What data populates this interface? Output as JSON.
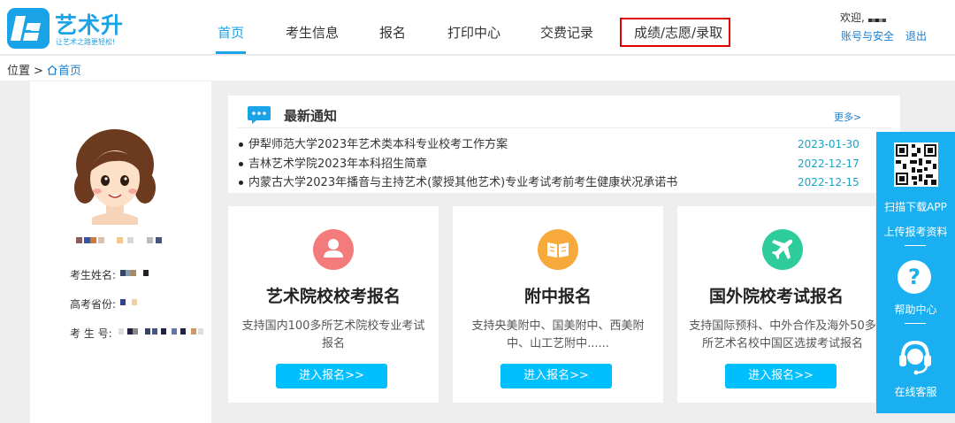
{
  "brand": {
    "name": "艺术升",
    "slogan": "让艺术之路更轻松!",
    "color": "#1aa3e6"
  },
  "nav": {
    "items": [
      {
        "label": "首页"
      },
      {
        "label": "考生信息"
      },
      {
        "label": "报名"
      },
      {
        "label": "打印中心"
      },
      {
        "label": "交费记录"
      },
      {
        "label": "成绩/志愿/录取"
      }
    ],
    "active_index": 0,
    "highlighted_index": 5
  },
  "user": {
    "welcome": "欢迎,",
    "account_link": "账号与安全",
    "logout_link": "退出"
  },
  "breadcrumb": {
    "label": "位置",
    "separator": ">",
    "home": "首页"
  },
  "profile": {
    "name_label": "考生姓名:",
    "province_label": "高考省份:",
    "id_label": "考 生 号:"
  },
  "notice": {
    "title": "最新通知",
    "more": "更多>",
    "items": [
      {
        "text": "伊犁师范大学2023年艺术类本科专业校考工作方案",
        "date": "2023-01-30"
      },
      {
        "text": "吉林艺术学院2023年本科招生简章",
        "date": "2022-12-17"
      },
      {
        "text": "内蒙古大学2023年播音与主持艺术(蒙授其他艺术)专业考试考前考生健康状况承诺书",
        "date": "2022-12-15"
      }
    ]
  },
  "cards": [
    {
      "title": "艺术院校校考报名",
      "desc": "支持国内100多所艺术院校专业考试报名",
      "button": "进入报名>>",
      "icon": "person-icon",
      "icon_color": "#f47b7b"
    },
    {
      "title": "附中报名",
      "desc": "支持央美附中、国美附中、西美附中、山工艺附中......",
      "button": "进入报名>>",
      "icon": "book-icon",
      "icon_color": "#f7a93b"
    },
    {
      "title": "国外院校考试报名",
      "desc": "支持国际预科、中外合作及海外50多所艺术名校中国区选拔考试报名",
      "button": "进入报名>>",
      "icon": "airplane-icon",
      "icon_color": "#2ecc9a"
    }
  ],
  "side": {
    "scan": "扫描下载APP",
    "upload": "上传报考资料",
    "help": "帮助中心",
    "help_glyph": "?",
    "service": "在线客服"
  }
}
